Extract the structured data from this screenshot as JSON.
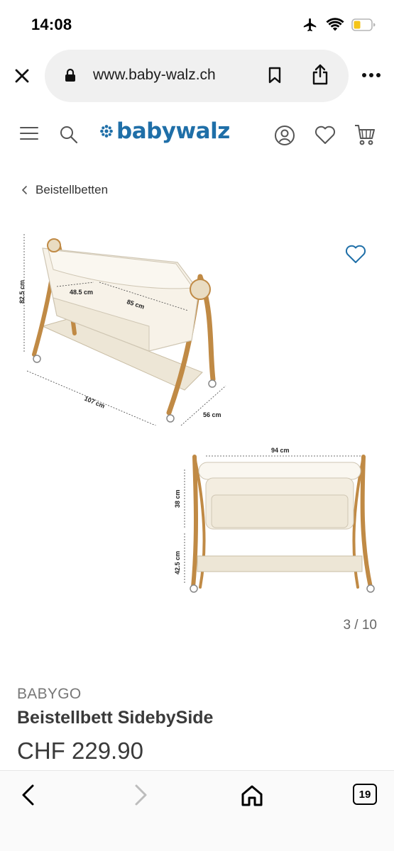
{
  "status_bar": {
    "time": "14:08",
    "icons": [
      "airplane-icon",
      "wifi-icon",
      "battery-icon"
    ],
    "battery_color": "#f5c518"
  },
  "browser": {
    "url": "www.baby-walz.ch",
    "icons": [
      "close-icon",
      "lock-icon",
      "bookmark-icon",
      "share-icon",
      "more-icon"
    ]
  },
  "header": {
    "logo_text": "babywalz",
    "brand_color": "#1f6fa8",
    "icons": [
      "menu-icon",
      "search-icon",
      "account-icon",
      "heart-icon",
      "cart-icon"
    ]
  },
  "breadcrumb": {
    "label": "Beistellbetten"
  },
  "gallery": {
    "image1_dims": {
      "height": "82.5 cm",
      "inner_width": "48.5 cm",
      "inner_length": "85 cm",
      "length": "107 cm",
      "depth": "56 cm"
    },
    "image2_dims": {
      "width": "94 cm",
      "bed_height": "38 cm",
      "leg_height": "42.5 cm"
    },
    "counter": "3 / 10",
    "current_image": 3,
    "total_images": 10
  },
  "product": {
    "brand": "BABYGO",
    "title": "Beistellbett SidebySide",
    "price": "CHF 229.90"
  },
  "toolbar": {
    "tab_count": "19",
    "icons": [
      "back-icon",
      "forward-icon",
      "home-icon",
      "tabs-icon"
    ]
  }
}
